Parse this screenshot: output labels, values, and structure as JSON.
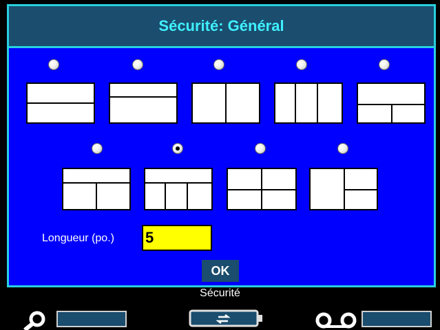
{
  "dialog": {
    "title": "Sécurité: Général",
    "length_label": "Longueur (po.)",
    "length_value": "5",
    "ok_label": "OK"
  },
  "layouts": [
    {
      "id": "layout-1",
      "selected": false
    },
    {
      "id": "layout-2",
      "selected": false
    },
    {
      "id": "layout-3",
      "selected": false
    },
    {
      "id": "layout-4",
      "selected": false
    },
    {
      "id": "layout-5",
      "selected": false
    },
    {
      "id": "layout-6",
      "selected": false
    },
    {
      "id": "layout-7",
      "selected": true
    },
    {
      "id": "layout-8",
      "selected": false
    },
    {
      "id": "layout-9",
      "selected": false
    }
  ],
  "statusbar": {
    "mode_label": "Sécurité",
    "icons": [
      "magnifier-icon",
      "power-plug-icon",
      "tape-cassette-icon"
    ]
  },
  "colors": {
    "dialog_bg": "#0000ff",
    "title_bar": "#1a4d6e",
    "title_text": "#3ff0ff",
    "input_bg": "#ffff00"
  }
}
